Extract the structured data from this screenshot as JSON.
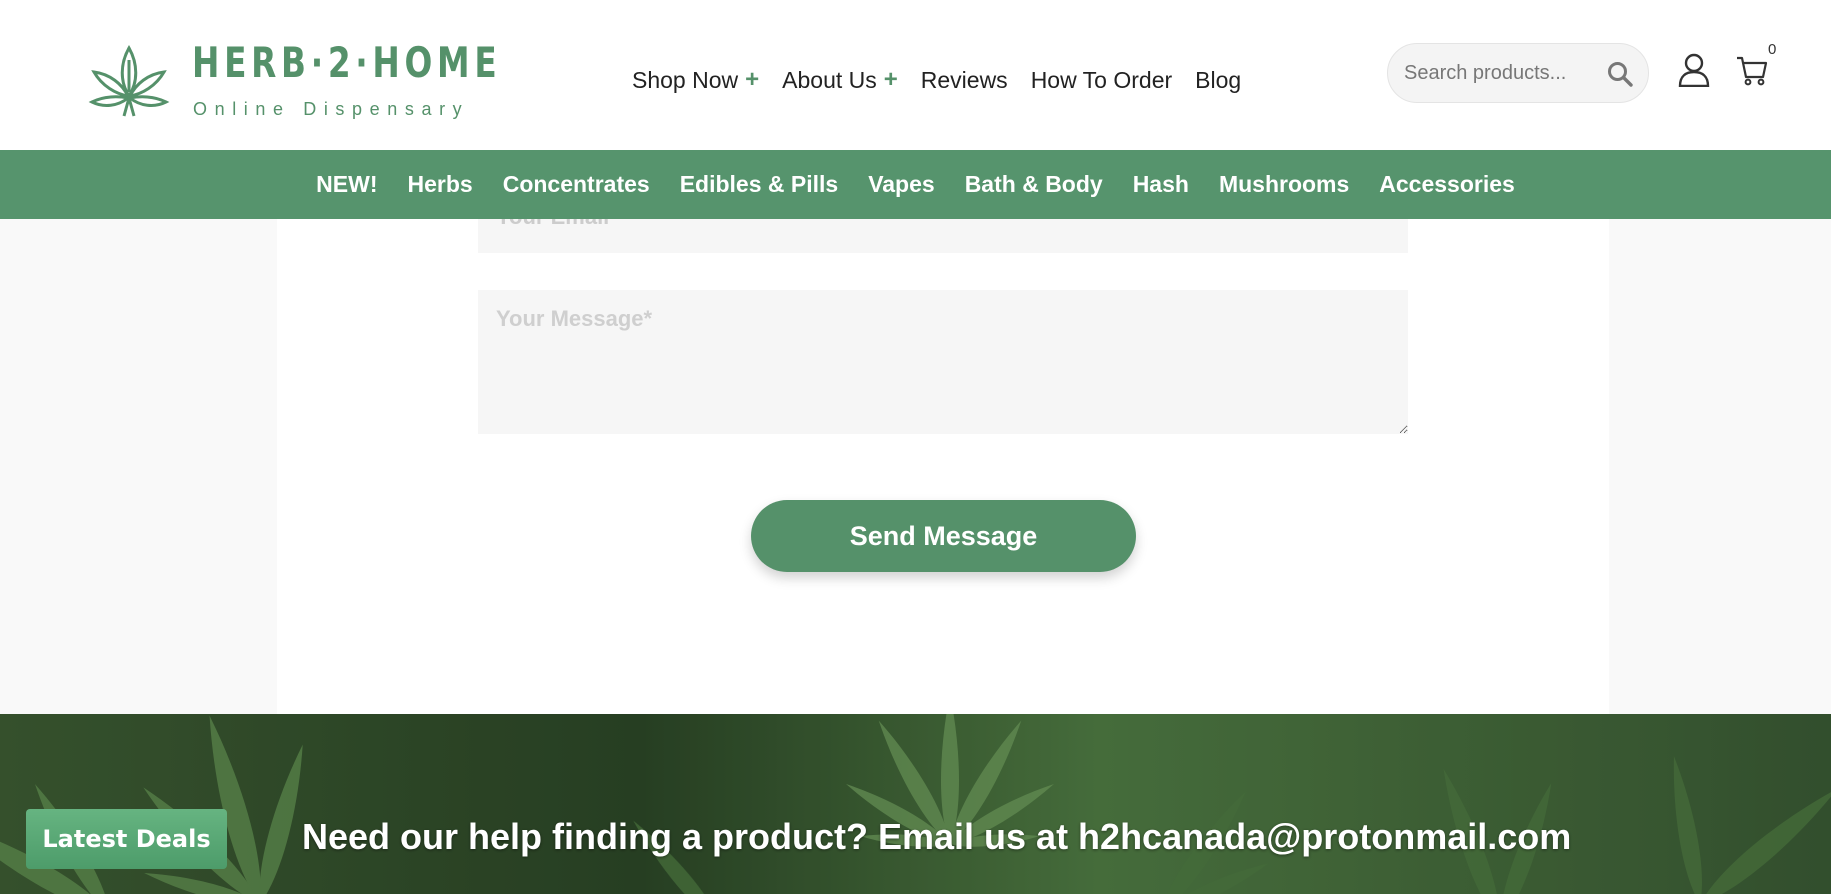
{
  "header": {
    "logo": {
      "title": "HERB·2·HOME",
      "subtitle": "Online Dispensary"
    },
    "nav": [
      {
        "label": "Shop Now",
        "has_submenu": true
      },
      {
        "label": "About Us",
        "has_submenu": true
      },
      {
        "label": "Reviews",
        "has_submenu": false
      },
      {
        "label": "How To Order",
        "has_submenu": false
      },
      {
        "label": "Blog",
        "has_submenu": false
      }
    ],
    "submenu_glyph": "+",
    "search": {
      "placeholder": "Search products...",
      "icon": "search-icon"
    },
    "account_icon": "user-icon",
    "cart": {
      "icon": "cart-icon",
      "count": "0"
    }
  },
  "categories": [
    "NEW!",
    "Herbs",
    "Concentrates",
    "Edibles & Pills",
    "Vapes",
    "Bath & Body",
    "Hash",
    "Mushrooms",
    "Accessories"
  ],
  "form": {
    "email_placeholder": "Your Email",
    "message_placeholder": "Your Message*",
    "submit_label": "Send Message"
  },
  "banner": {
    "deals_label": "Latest Deals",
    "help_text": "Need our help finding a product? Email us at h2hcanada@protonmail.com"
  },
  "colors": {
    "brand_green": "#55916a",
    "category_bar": "#56946d",
    "deals_button": "#5aa877"
  }
}
